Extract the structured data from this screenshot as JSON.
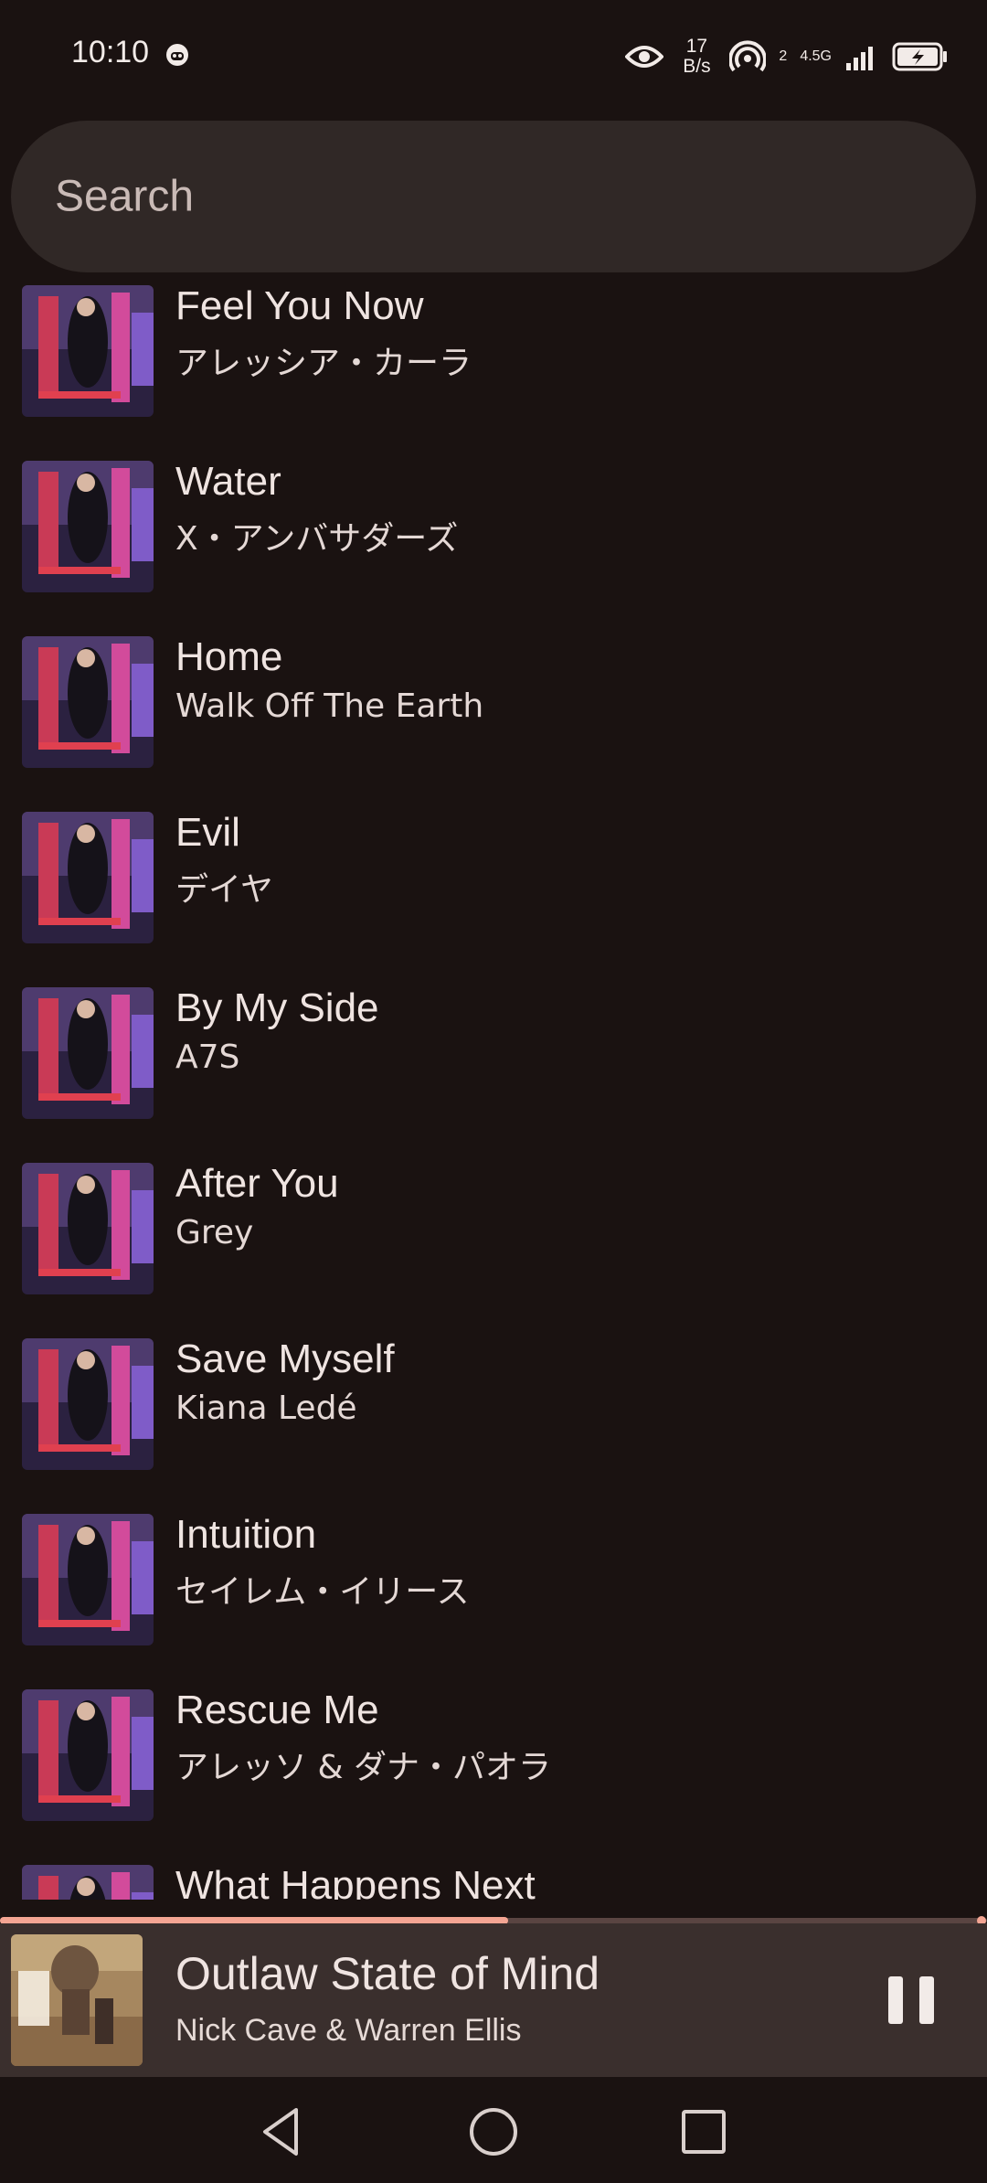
{
  "status_bar": {
    "time": "10:10",
    "net_speed_value": "17",
    "net_speed_unit": "B/s",
    "sim_label": "2",
    "network_type": "4.5G",
    "icons": [
      "face-icon",
      "eye-icon",
      "hotspot-icon",
      "signal-icon",
      "battery-charging-icon"
    ]
  },
  "search": {
    "placeholder": "Search"
  },
  "tracks": [
    {
      "title": "Feel You Now",
      "artist": "アレッシア・カーラ"
    },
    {
      "title": "Water",
      "artist": "X・アンバサダーズ"
    },
    {
      "title": "Home",
      "artist": "Walk Off The Earth"
    },
    {
      "title": "Evil",
      "artist": "デイヤ"
    },
    {
      "title": "By My Side",
      "artist": "A7S"
    },
    {
      "title": "After You",
      "artist": "Grey"
    },
    {
      "title": "Save Myself",
      "artist": "Kiana Ledé"
    },
    {
      "title": "Intuition",
      "artist": "セイレム・イリース"
    },
    {
      "title": "Rescue Me",
      "artist": "アレッソ & ダナ・パオラ"
    },
    {
      "title": "What Happens Next",
      "artist": ""
    }
  ],
  "now_playing": {
    "title": "Outlaw State of Mind",
    "artist": "Nick Cave & Warren Ellis",
    "progress": 0.515
  },
  "colors": {
    "background": "#1a1211",
    "accent": "#f4a593",
    "mini_player": "#3a2f2d"
  },
  "nav": {
    "icons": [
      "back-icon",
      "home-icon",
      "recents-icon"
    ]
  }
}
